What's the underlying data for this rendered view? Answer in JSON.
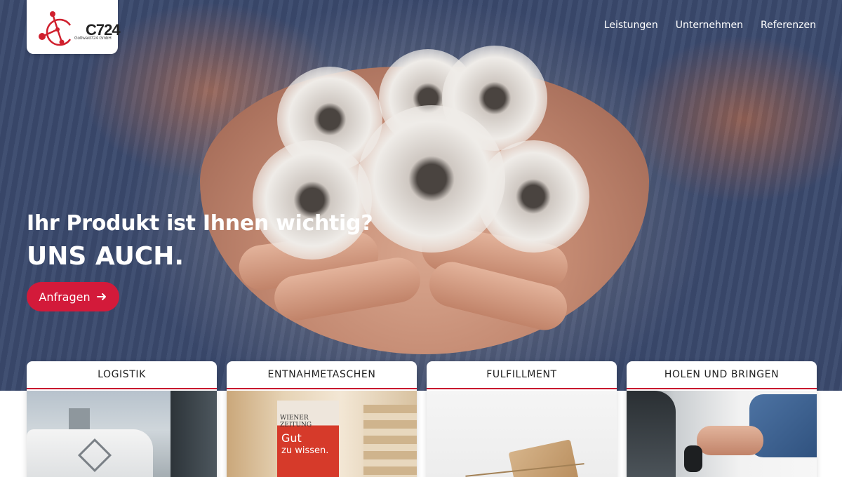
{
  "brand": {
    "logo_mark": "C724",
    "logo_sub": "Gottwald724 GmbH",
    "accent": "#d31a3a",
    "logo_color": "#d0202e"
  },
  "nav": {
    "items": [
      {
        "label": "Leistungen"
      },
      {
        "label": "Unternehmen"
      },
      {
        "label": "Referenzen"
      }
    ]
  },
  "hero": {
    "headline": "Ihr Produkt ist Ihnen wichtig?",
    "subheadline": "UNS AUCH.",
    "cta_label": "Anfragen",
    "cta_icon": "arrow-right-icon",
    "image": "hands holding dandelion puffballs"
  },
  "cards": [
    {
      "title": "LOGISTIK",
      "image": "delivery van and city towers"
    },
    {
      "title": "ENTNAHMETASCHEN",
      "image": "newspaper bag on city street",
      "image_text_1": "WIENER ZEITUNG",
      "image_text_2": "Gut",
      "image_text_3": "zu wissen."
    },
    {
      "title": "FULFILLMENT",
      "image": "wrapped parcel with string"
    },
    {
      "title": "HOLEN UND BRINGEN",
      "image": "hand holding car key beside car"
    }
  ]
}
